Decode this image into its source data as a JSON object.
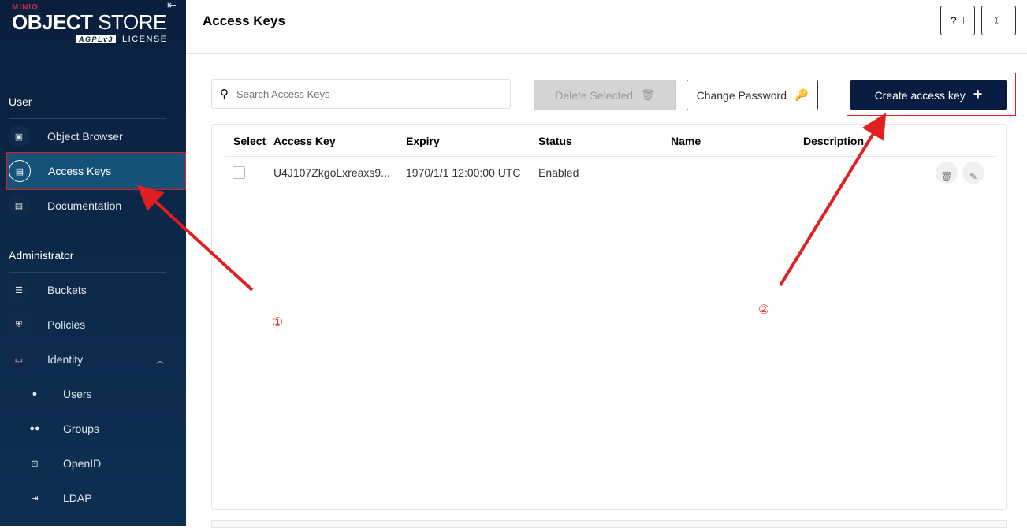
{
  "sidebar": {
    "brand": "MINIO",
    "product_bold": "OBJECT",
    "product": "STORE",
    "agpl": "AGPLv3",
    "license": "LICENSE",
    "user_section": "User",
    "admin_section": "Administrator",
    "items": [
      {
        "label": "Object Browser",
        "icon": "object-browser-icon"
      },
      {
        "label": "Access Keys",
        "icon": "access-keys-icon",
        "active": true
      },
      {
        "label": "Documentation",
        "icon": "documentation-icon"
      },
      {
        "label": "Buckets",
        "icon": "buckets-icon"
      },
      {
        "label": "Policies",
        "icon": "policies-icon"
      },
      {
        "label": "Identity",
        "icon": "identity-icon",
        "expanded": true
      },
      {
        "label": "Users",
        "icon": "user-icon"
      },
      {
        "label": "Groups",
        "icon": "groups-icon"
      },
      {
        "label": "OpenID",
        "icon": "openid-icon"
      },
      {
        "label": "LDAP",
        "icon": "ldap-icon"
      }
    ]
  },
  "header": {
    "title": "Access Keys"
  },
  "toolbar": {
    "search_placeholder": "Search Access Keys",
    "delete_label": "Delete Selected",
    "change_password_label": "Change Password",
    "create_label": "Create access key"
  },
  "table": {
    "columns": [
      "Select",
      "Access Key",
      "Expiry",
      "Status",
      "Name",
      "Description"
    ],
    "rows": [
      {
        "access_key": "U4J107ZkgoLxreaxs9...",
        "expiry": "1970/1/1 12:00:00 UTC",
        "status": "Enabled",
        "name": "",
        "description": ""
      }
    ]
  },
  "annotations": {
    "step1": "①",
    "step2": "②",
    "color": "#e02020"
  }
}
